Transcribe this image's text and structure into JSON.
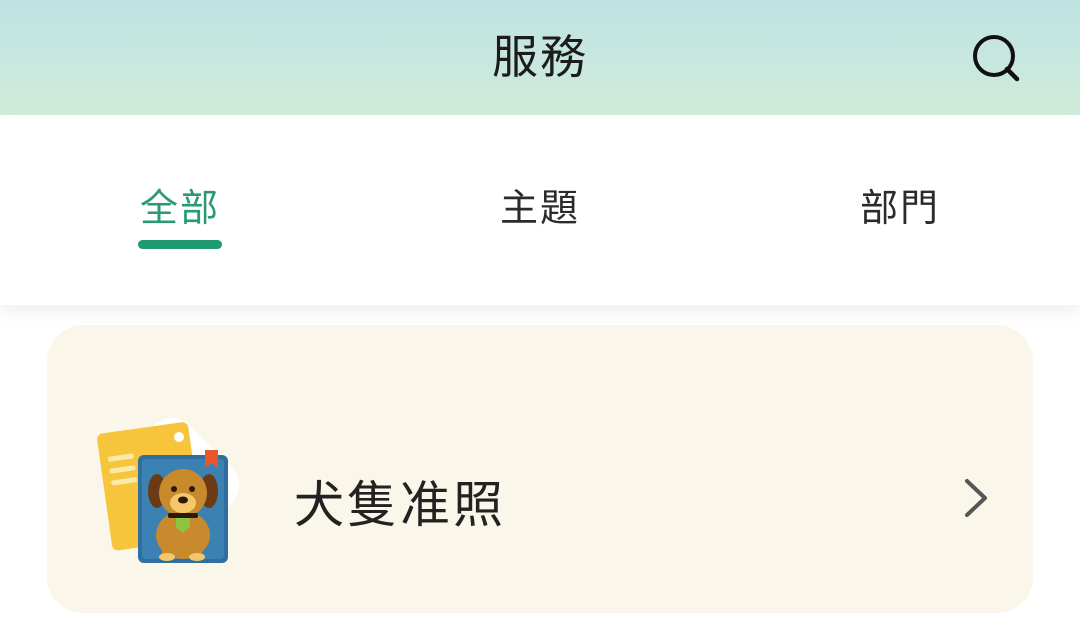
{
  "header": {
    "title": "服務",
    "search_icon": "search-icon"
  },
  "tabs": [
    {
      "label": "全部",
      "active": true
    },
    {
      "label": "主題",
      "active": false
    },
    {
      "label": "部門",
      "active": false
    }
  ],
  "services": [
    {
      "title": "犬隻准照",
      "icon": "dog-license-icon",
      "chevron": "chevron-right-icon"
    }
  ],
  "colors": {
    "accent": "#1f9a72",
    "header_bg": "#c4e6df",
    "card_bg": "#fbf6ea"
  }
}
